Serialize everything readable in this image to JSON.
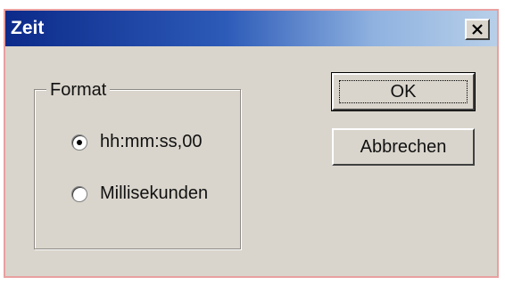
{
  "window": {
    "title": "Zeit",
    "close_icon": "close-icon"
  },
  "format_group": {
    "label": "Format",
    "options": [
      {
        "label": "hh:mm:ss,00",
        "selected": true
      },
      {
        "label": "Millisekunden",
        "selected": false
      }
    ]
  },
  "buttons": {
    "ok_label": "OK",
    "cancel_label": "Abbrechen"
  }
}
